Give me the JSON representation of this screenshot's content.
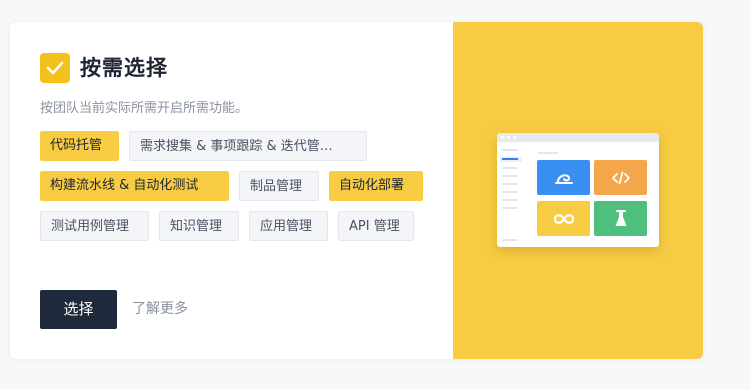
{
  "feature": {
    "title": "按需选择",
    "checked": true,
    "description": "按团队当前实际所需开启所需功能。",
    "tags": [
      {
        "label": "代码托管",
        "selected": true
      },
      {
        "label": "需求搜集 & 事项跟踪 & 迭代管…",
        "selected": false
      },
      {
        "label": "构建流水线 & 自动化测试",
        "selected": true
      },
      {
        "label": "制品管理",
        "selected": false
      },
      {
        "label": "自动化部署",
        "selected": true
      },
      {
        "label": "测试用例管理",
        "selected": false
      },
      {
        "label": "知识管理",
        "selected": false
      },
      {
        "label": "应用管理",
        "selected": false
      },
      {
        "label": "API 管理",
        "selected": false
      }
    ],
    "actions": {
      "select_label": "选择",
      "learn_more_label": "了解更多"
    }
  },
  "illustration": {
    "tiles": [
      {
        "icon": "project-icon",
        "color": "#3a8ff2"
      },
      {
        "icon": "code-icon",
        "color": "#f4a64a"
      },
      {
        "icon": "infinity-icon",
        "color": "#f8cc42"
      },
      {
        "icon": "flask-icon",
        "color": "#4fbf7e"
      }
    ]
  },
  "colors": {
    "accent": "#f8cc42",
    "check": "#f3c11c",
    "primary_button": "#1e2a3b",
    "tag_selected": "#f8cc42",
    "tag_unselected": "#f3f5f8"
  }
}
